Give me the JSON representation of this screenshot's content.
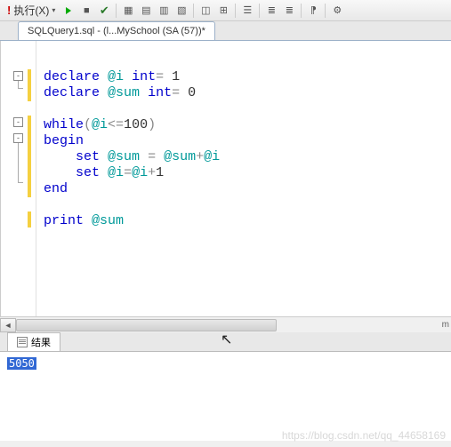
{
  "toolbar": {
    "execute_label": "执行(X)",
    "icons": [
      "debug",
      "stop",
      "check",
      "sep",
      "grid1",
      "grid2",
      "grid3",
      "grid4",
      "sep",
      "pane1",
      "pane2",
      "sep",
      "list",
      "sep",
      "indent1",
      "indent2",
      "sep",
      "comment",
      "sep",
      "opts"
    ]
  },
  "tab": {
    "title": "SQLQuery1.sql - (l...MySchool (SA (57))*"
  },
  "code": {
    "line1": "",
    "line2_kw1": "declare",
    "line2_var": "@i",
    "line2_kw2": "int",
    "line2_op": "=",
    "line2_val": "1",
    "line3_kw1": "declare",
    "line3_var": "@sum",
    "line3_kw2": "int",
    "line3_op": "=",
    "line3_val": "0",
    "line4": "",
    "line5_kw": "while",
    "line5_op1": "(",
    "line5_var": "@i",
    "line5_op2": "<=",
    "line5_val": "100",
    "line5_op3": ")",
    "line6_kw": "begin",
    "line7_kw": "set",
    "line7_var1": "@sum",
    "line7_op1": "=",
    "line7_var2": "@sum",
    "line7_op2": "+",
    "line7_var3": "@i",
    "line8_kw": "set",
    "line8_var1": "@i",
    "line8_op1": "=",
    "line8_var2": "@i",
    "line8_op2": "+",
    "line8_val": "1",
    "line9_kw": "end",
    "line10": "",
    "line11_kw": "print",
    "line11_var": "@sum"
  },
  "results": {
    "tab_label": "结果",
    "value": "5050"
  },
  "watermark": "https://blog.csdn.net/qq_44658169"
}
